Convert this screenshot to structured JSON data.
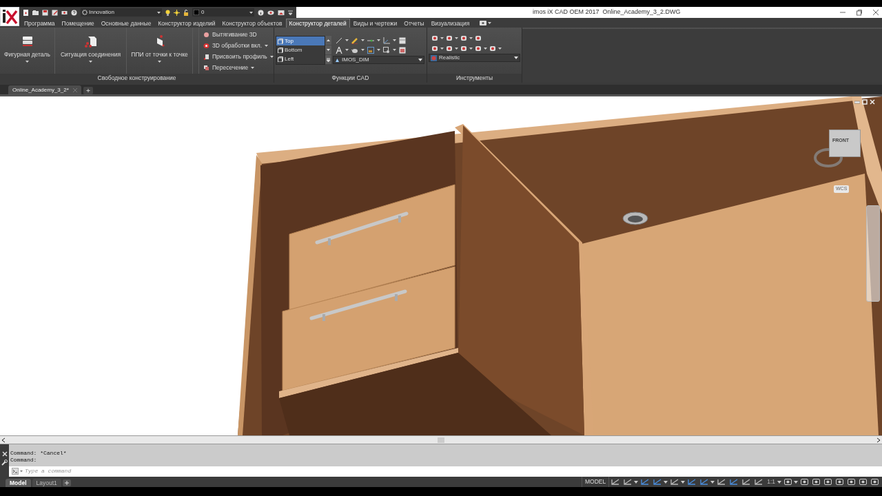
{
  "window": {
    "title": "imos iX CAD OEM 2017",
    "document": "Online_Academy_3_2.DWG"
  },
  "quick_access": {
    "workspace": "Innovation",
    "layer": "0"
  },
  "ribbon_tabs": [
    {
      "label": "Программа",
      "selected": false
    },
    {
      "label": "Помещение",
      "selected": false
    },
    {
      "label": "Основные данные",
      "selected": false
    },
    {
      "label": "Конструктор изделий",
      "selected": false
    },
    {
      "label": "Конструктор объектов",
      "selected": false
    },
    {
      "label": "Конструктор деталей",
      "selected": true
    },
    {
      "label": "Виды и чертежи",
      "selected": false
    },
    {
      "label": "Отчеты",
      "selected": false
    },
    {
      "label": "Визуализация",
      "selected": false
    }
  ],
  "panel_free_design": {
    "title": "Свободное конструирование",
    "large_buttons": [
      "Фигурная деталь",
      "Ситуация соединения",
      "ППИ от точки к точке"
    ],
    "small_buttons": [
      {
        "label": "Вытягивание 3D",
        "dropdown": false
      },
      {
        "label": "3D обработки вкл.",
        "dropdown": true
      },
      {
        "label": "Присвоить профиль",
        "dropdown": true
      },
      {
        "label": "Пересечение",
        "dropdown": true
      }
    ]
  },
  "panel_cad": {
    "title": "Функции CAD",
    "views": [
      {
        "label": "Top",
        "selected": true
      },
      {
        "label": "Bottom",
        "selected": false
      },
      {
        "label": "Left",
        "selected": false
      }
    ],
    "dim_style": "IMOS_DIM"
  },
  "panel_tools": {
    "title": "Инструменты",
    "visual_style": "Realistic"
  },
  "file_tabs": [
    {
      "label": "Online_Academy_3_2*",
      "selected": true
    }
  ],
  "viewcube": {
    "face": "FRONT",
    "ucs": "WCS"
  },
  "command_history": [
    "Command: *Cancel*",
    "Command:"
  ],
  "command_input": {
    "placeholder": "Type a command"
  },
  "layout_tabs": [
    {
      "label": "Model",
      "selected": true
    },
    {
      "label": "Layout1",
      "selected": false
    }
  ],
  "status_bar": {
    "space": "MODEL",
    "scale": "1:1"
  }
}
